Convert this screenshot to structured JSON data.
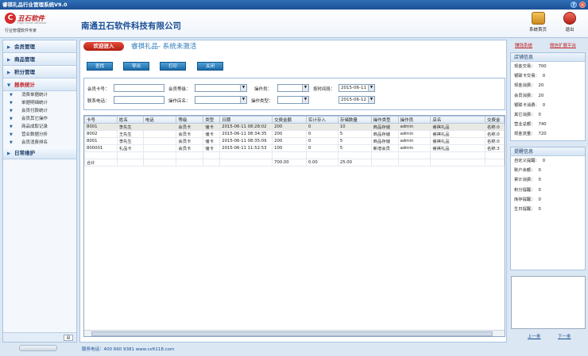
{
  "window": {
    "title": "睿祺礼品行业管理系统V9.0",
    "help_glyph": "?",
    "close_glyph": "×"
  },
  "header": {
    "logo_mark": "C",
    "logo_name": "丑石软件",
    "logo_en": "High Grade Software",
    "logo_sub": "行业管理软件专家",
    "company": "南通丑石软件科技有限公司",
    "home_label": "系统首页",
    "exit_label": "退出"
  },
  "sidebar": {
    "groups": [
      "会员管理",
      "商品管理",
      "积分管理",
      "报表统计",
      "日常维护"
    ],
    "report_items": [
      "消费单据统计",
      "单据明细统计",
      "会员付款统计",
      "会员其它操作",
      "商品成取记录",
      "营业数据分析",
      "会员消费排名"
    ]
  },
  "main": {
    "welcome": "欢迎进入",
    "status": "睿祺礼品- 系统未激活",
    "buttons": [
      "查找",
      "导出",
      "打印",
      "关闭"
    ],
    "filter": {
      "card_label": "会员卡号：",
      "phone_label": "联系电话：",
      "level_label": "会员等级：",
      "store_label": "操作店名：",
      "operator_label": "操作员：",
      "optype_label": "操作类型：",
      "time_label": "按时间段：",
      "date_from": "2015-06-11",
      "date_to": "2015-06-12"
    },
    "table": {
      "headers": [
        "卡号",
        "姓名",
        "电话",
        "等级",
        "类型",
        "日期",
        "交费金额",
        "实计存入",
        "存储数量",
        "操作类型",
        "操作员",
        "店名",
        "交费金"
      ],
      "rows": [
        [
          "8001",
          "李先生",
          "",
          "会员卡",
          "储卡",
          "2015-06-11 08:28:02",
          "200",
          "0",
          "10",
          "商品存储",
          "admin",
          "睿祺礼品",
          "名称:0"
        ],
        [
          "8002",
          "王先生",
          "",
          "会员卡",
          "储卡",
          "2015-06-11 08:34:35",
          "200",
          "0",
          "5",
          "商品存储",
          "admin",
          "睿祺礼品",
          "名称:0"
        ],
        [
          "8001",
          "李先生",
          "",
          "会员卡",
          "储卡",
          "2015-06-11 08:35:09",
          "200",
          "0",
          "5",
          "商品存储",
          "admin",
          "睿祺礼品",
          "名称:0"
        ],
        [
          "800001",
          "礼品卡",
          "",
          "会员卡",
          "储卡",
          "2015-06-11 11:52:53",
          "100",
          "0",
          "5",
          "新增会员",
          "admin",
          "睿祺礼品",
          "名称:3"
        ]
      ],
      "total": [
        "合计",
        "",
        "",
        "",
        "",
        "",
        "700.00",
        "0.00",
        "25.00",
        "",
        "",
        "",
        ""
      ]
    }
  },
  "right": {
    "link1": "赚钱系统",
    "link2": "微信扩展平台",
    "store_title": "店铺信息",
    "store_items": [
      {
        "k": "现金交易：",
        "v": "700"
      },
      {
        "k": "银联卡交易：",
        "v": "0"
      },
      {
        "k": "现金消费：",
        "v": "20"
      },
      {
        "k": "会员消费：",
        "v": "20"
      },
      {
        "k": "银联卡消费：",
        "v": "0"
      },
      {
        "k": "其它消费：",
        "v": "0"
      },
      {
        "k": "营业总额：",
        "v": "740"
      },
      {
        "k": "现金流量：",
        "v": "720"
      }
    ],
    "alert_title": "提醒信息",
    "alert_items": [
      {
        "k": "自定义提醒：",
        "v": "0"
      },
      {
        "k": "账户余额：",
        "v": "0"
      },
      {
        "k": "累计消费：",
        "v": "0"
      },
      {
        "k": "积分提醒：",
        "v": "0"
      },
      {
        "k": "库存提醒：",
        "v": "0"
      },
      {
        "k": "生日提醒：",
        "v": "0"
      }
    ],
    "prev": "上一条",
    "next": "下一条"
  },
  "footer": {
    "hotline": "服务电话：400 660 9381 www.csft118.com"
  }
}
